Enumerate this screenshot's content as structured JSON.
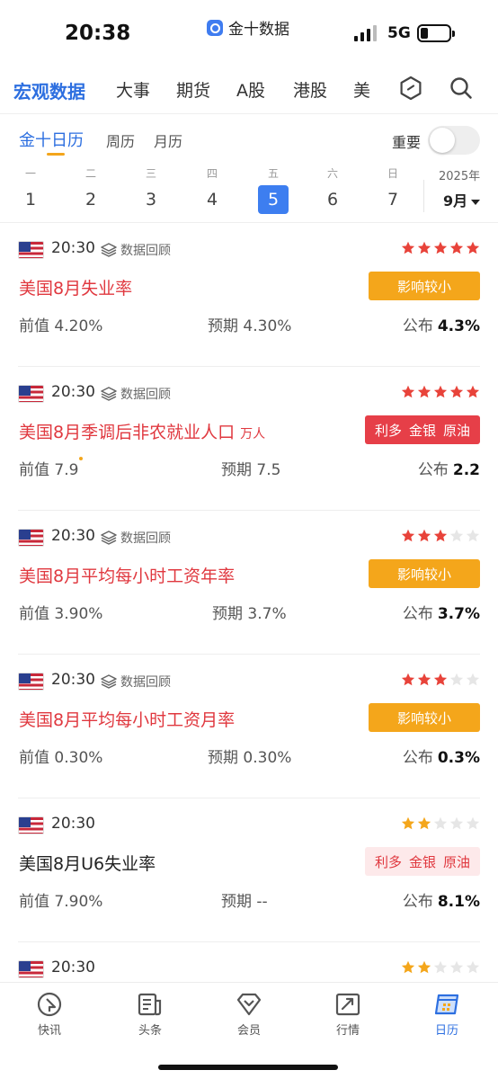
{
  "status_bar": {
    "time": "20:38",
    "app_name": "金十数据",
    "network": "5G"
  },
  "top_tabs": [
    {
      "label": "宏观数据",
      "active": true
    },
    {
      "label": "大事"
    },
    {
      "label": "期货"
    },
    {
      "label": "A股"
    },
    {
      "label": "港股"
    },
    {
      "label": "美"
    }
  ],
  "sub_tabs": [
    {
      "label": "金十日历",
      "active": true
    },
    {
      "label": "周历"
    },
    {
      "label": "月历"
    }
  ],
  "important_label": "重要",
  "week": {
    "days": [
      {
        "wd": "一",
        "d": "1"
      },
      {
        "wd": "二",
        "d": "2"
      },
      {
        "wd": "三",
        "d": "3"
      },
      {
        "wd": "四",
        "d": "4"
      },
      {
        "wd": "五",
        "d": "5",
        "active": true
      },
      {
        "wd": "六",
        "d": "6"
      },
      {
        "wd": "日",
        "d": "7"
      }
    ],
    "year": "2025年",
    "month": "9月"
  },
  "items": [
    {
      "time": "20:30",
      "review": "数据回顾",
      "stars": 5,
      "title": "美国8月失业率",
      "title_color": "red",
      "unit": "",
      "badge_type": "orange",
      "badge_text": "影响较小",
      "prev_label": "前值",
      "prev": "4.20%",
      "expected_label": "预期",
      "expected": "4.30%",
      "published_label": "公布",
      "published": "4.3%"
    },
    {
      "time": "20:30",
      "review": "数据回顾",
      "stars": 5,
      "title": "美国8月季调后非农就业人口",
      "title_color": "red",
      "unit": "万人",
      "badge_type": "red",
      "badge_tags": [
        "利多",
        "金银",
        "原油"
      ],
      "prev_label": "前值",
      "prev": "7.9",
      "prev_dot": true,
      "expected_label": "预期",
      "expected": "7.5",
      "published_label": "公布",
      "published": "2.2"
    },
    {
      "time": "20:30",
      "review": "数据回顾",
      "stars": 3,
      "title": "美国8月平均每小时工资年率",
      "title_color": "red",
      "unit": "",
      "badge_type": "orange",
      "badge_text": "影响较小",
      "prev_label": "前值",
      "prev": "3.90%",
      "expected_label": "预期",
      "expected": "3.7%",
      "published_label": "公布",
      "published": "3.7%"
    },
    {
      "time": "20:30",
      "review": "数据回顾",
      "stars": 3,
      "title": "美国8月平均每小时工资月率",
      "title_color": "red",
      "unit": "",
      "badge_type": "orange",
      "badge_text": "影响较小",
      "prev_label": "前值",
      "prev": "0.30%",
      "expected_label": "预期",
      "expected": "0.30%",
      "published_label": "公布",
      "published": "0.3%"
    },
    {
      "time": "20:30",
      "review": "",
      "stars": 2,
      "title": "美国8月U6失业率",
      "title_color": "black",
      "unit": "",
      "badge_type": "pink",
      "badge_tags": [
        "利多",
        "金银",
        "原油"
      ],
      "prev_label": "前值",
      "prev": "7.90%",
      "expected_label": "预期",
      "expected": "--",
      "published_label": "公布",
      "published": "8.1%"
    },
    {
      "time": "20:30",
      "review": "",
      "stars": 2,
      "title": "",
      "title_color": "black",
      "unit": "",
      "badge_type": "",
      "badge_text": "",
      "prev_label": "",
      "prev": "",
      "expected_label": "",
      "expected": "",
      "published_label": "",
      "published": ""
    }
  ],
  "bottom_nav": [
    {
      "label": "快讯",
      "icon": "flash-news-icon"
    },
    {
      "label": "头条",
      "icon": "headline-icon"
    },
    {
      "label": "会员",
      "icon": "vip-icon"
    },
    {
      "label": "行情",
      "icon": "market-icon"
    },
    {
      "label": "日历",
      "icon": "calendar-icon",
      "active": true
    }
  ],
  "colors": {
    "accent": "#2d6fe0",
    "red": "#e0383f",
    "orange": "#f4a61b",
    "star_red": "#e8433a",
    "star_yellow": "#f4a61b",
    "star_empty": "#e6e6e6"
  }
}
